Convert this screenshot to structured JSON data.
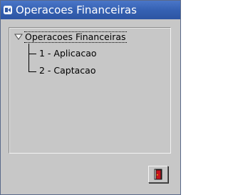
{
  "window": {
    "title": "Operacoes Financeiras"
  },
  "tree": {
    "root": {
      "label": "Operacoes Financeiras",
      "expanded": true
    },
    "children": [
      {
        "label": "1 - Aplicacao"
      },
      {
        "label": "2 - Captacao"
      }
    ]
  },
  "buttons": {
    "exit": {
      "icon": "exit-door-icon"
    }
  },
  "colors": {
    "titlebar": "#3561b3",
    "background": "#c7c7c7",
    "door": "#c8141e"
  }
}
